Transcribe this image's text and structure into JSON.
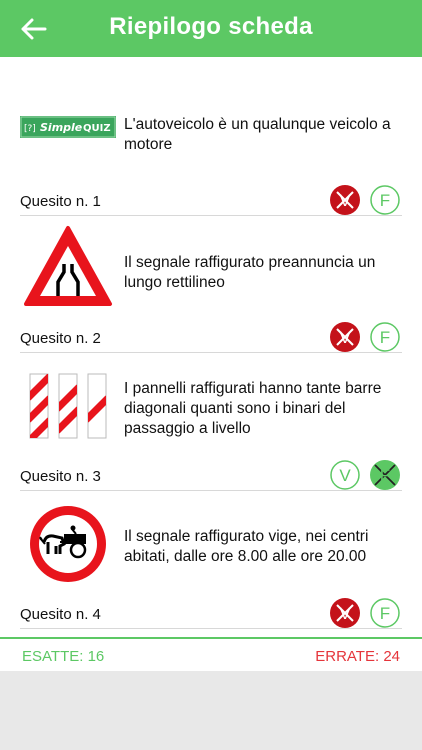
{
  "header": {
    "title": "Riepilogo scheda",
    "back_icon": "arrow-left-icon",
    "color": "#5cc864"
  },
  "logo": {
    "text_simple": "Simple",
    "text_quiz": "QUIZ",
    "badge": "[?]"
  },
  "questions": [
    {
      "text": "L'autoveicolo è un qualunque veicolo a motore",
      "label": "Quesito n. 1",
      "image": "simplequiz-logo",
      "v_state": "wrong-selected",
      "f_state": "outline"
    },
    {
      "text": "Il segnale raffigurato preannuncia un lungo rettilineo",
      "label": "Quesito n. 2",
      "image": "road-narrows-sign",
      "v_state": "wrong-selected",
      "f_state": "outline"
    },
    {
      "text": "I pannelli raffigurati hanno tante barre diagonali quanti sono i binari del passaggio a livello",
      "label": "Quesito n. 3",
      "image": "level-crossing-panels",
      "v_state": "outline",
      "f_state": "wrong-selected"
    },
    {
      "text": "Il segnale raffigurato vige, nei centri abitati, dalle ore 8.00 alle ore 20.00",
      "label": "Quesito n. 4",
      "image": "no-horse-carts-sign",
      "v_state": "wrong-selected",
      "f_state": "outline"
    }
  ],
  "answer_letters": {
    "true": "V",
    "false": "F"
  },
  "footer": {
    "correct_label": "ESATTE: 16",
    "wrong_label": "ERRATE: 24",
    "correct_color": "#5cc864",
    "wrong_color": "#e5353b"
  }
}
